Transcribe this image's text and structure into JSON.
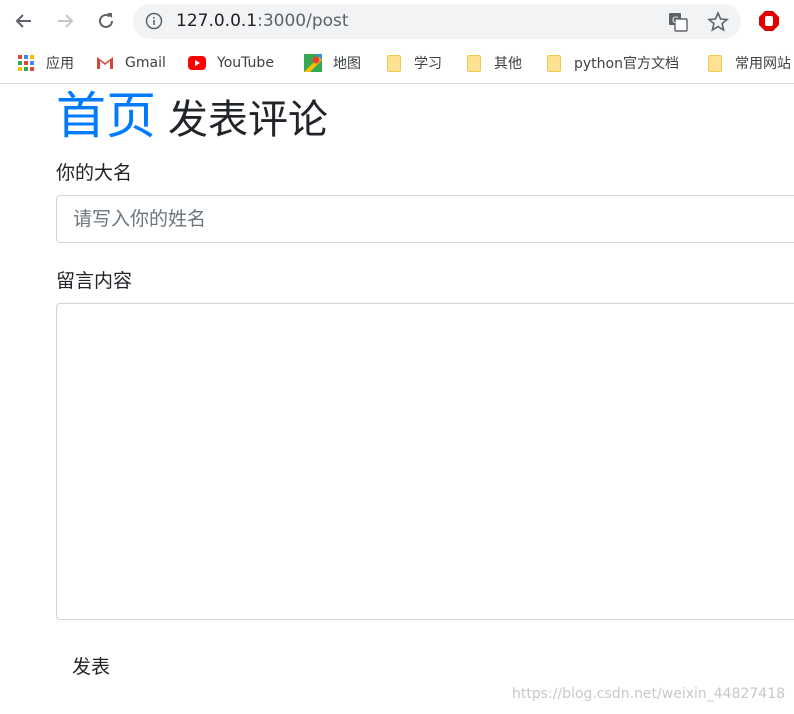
{
  "browser": {
    "url_host": "127.0.0.1",
    "url_path": ":3000/post",
    "bookmarks": [
      {
        "label": "应用",
        "icon": "apps-grid-icon"
      },
      {
        "label": "Gmail",
        "icon": "gmail-icon"
      },
      {
        "label": "YouTube",
        "icon": "youtube-icon"
      },
      {
        "label": "地图",
        "icon": "maps-icon"
      },
      {
        "label": "学习",
        "icon": "folder-icon"
      },
      {
        "label": "其他",
        "icon": "folder-icon"
      },
      {
        "label": "python官方文档",
        "icon": "folder-icon"
      },
      {
        "label": "常用网站",
        "icon": "folder-icon"
      }
    ]
  },
  "page": {
    "home_link": "首页",
    "title": "发表评论",
    "name_label": "你的大名",
    "name_placeholder": "请写入你的姓名",
    "name_value": "",
    "content_label": "留言内容",
    "content_value": "",
    "submit_label": "发表"
  },
  "watermark": "https://blog.csdn.net/weixin_44827418",
  "colors": {
    "link": "#007bff",
    "text": "#212529",
    "border": "#ced4da",
    "omnibox": "#f1f3f4"
  }
}
